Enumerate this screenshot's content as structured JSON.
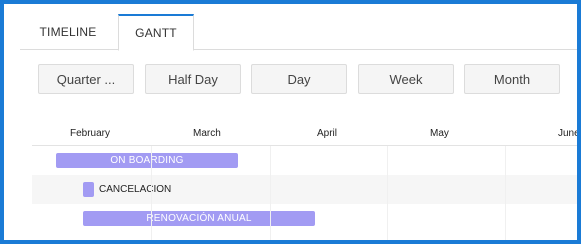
{
  "tabs": [
    {
      "label": "TIMELINE"
    },
    {
      "label": "GANTT"
    }
  ],
  "view_buttons": [
    {
      "label": "Quarter ..."
    },
    {
      "label": "Half Day"
    },
    {
      "label": "Day"
    },
    {
      "label": "Week"
    },
    {
      "label": "Month"
    }
  ],
  "timeline": {
    "months": [
      "February",
      "March",
      "April",
      "May",
      "June"
    ]
  },
  "tasks": [
    {
      "label": "ON BOARDING"
    },
    {
      "label": "CANCELACION"
    },
    {
      "label": "RENOVACIÓN ANUAL"
    }
  ],
  "colors": {
    "accent": "#1a7bd6",
    "task_bar": "#a29bf3"
  }
}
